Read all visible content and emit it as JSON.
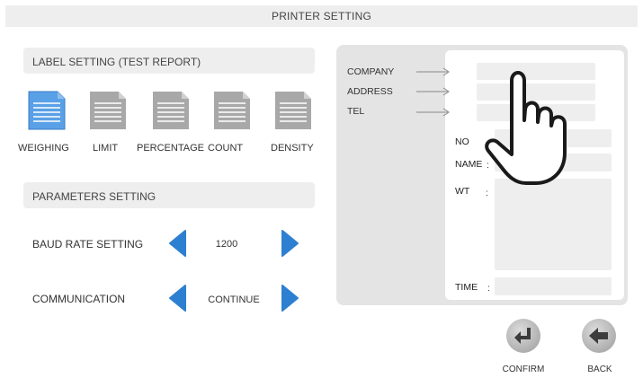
{
  "header": {
    "title": "PRINTER SETTING"
  },
  "label_setting": {
    "title": "LABEL SETTING (TEST REPORT)",
    "options": [
      {
        "label": "WEIGHING",
        "selected": true
      },
      {
        "label": "LIMIT",
        "selected": false
      },
      {
        "label": "PERCENTAGE",
        "selected": false
      },
      {
        "label": "COUNT",
        "selected": false
      },
      {
        "label": "DENSITY",
        "selected": false
      }
    ]
  },
  "parameters_setting": {
    "title": "PARAMETERS SETTING",
    "baud_rate": {
      "label": "BAUD RATE SETTING",
      "value": "1200"
    },
    "communication": {
      "label": "COMMUNICATION",
      "value": "CONTINUE"
    }
  },
  "preview": {
    "header_fields": [
      "COMPANY",
      "ADDRESS",
      "TEL"
    ],
    "fields": {
      "no": "NO",
      "name": "NAME",
      "wt": "WT",
      "time": "TIME"
    },
    "colon": ":"
  },
  "actions": {
    "confirm_label": "CONFIRM",
    "back_label": "BACK"
  },
  "colors": {
    "accent_blue": "#2d7fd1",
    "selected_icon": "#5aa0e6",
    "unselected_icon": "#a8a8a8",
    "button_gray": "#b9b9b9"
  },
  "icons": {
    "arrow_left": "triangle-left-icon",
    "arrow_right": "triangle-right-icon",
    "confirm": "enter-arrow-icon",
    "back": "back-arrow-icon",
    "document": "document-lines-icon",
    "hand": "pointing-hand-icon"
  }
}
